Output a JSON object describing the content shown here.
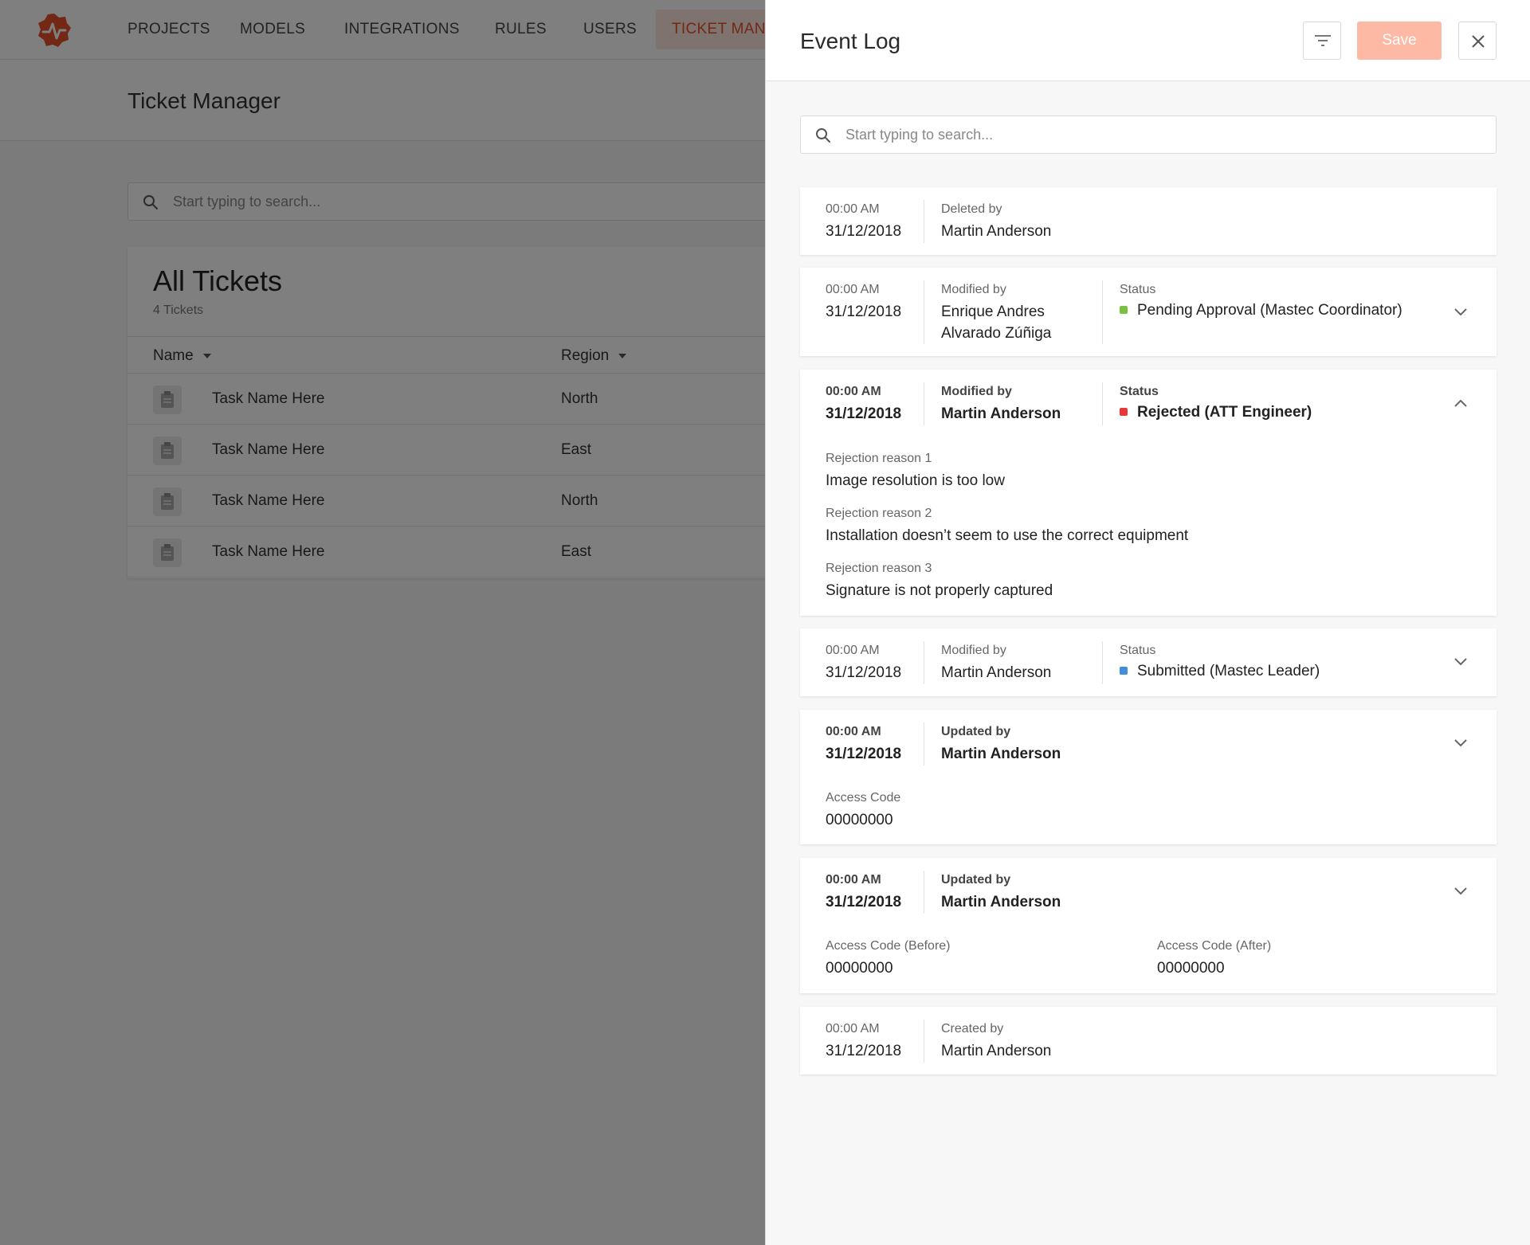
{
  "nav": {
    "items": [
      "PROJECTS",
      "MODELS",
      "INTEGRATIONS",
      "RULES",
      "USERS"
    ],
    "active_label": "TICKET MANA"
  },
  "page": {
    "title": "Ticket Manager"
  },
  "bg_search": {
    "placeholder": "Start typing to search..."
  },
  "tickets": {
    "title": "All Tickets",
    "count_label": "4 Tickets",
    "columns": [
      "Name",
      "Region"
    ],
    "rows": [
      {
        "name": "Task Name Here",
        "region": "North"
      },
      {
        "name": "Task Name Here",
        "region": "East"
      },
      {
        "name": "Task Name Here",
        "region": "North"
      },
      {
        "name": "Task Name Here",
        "region": "East"
      }
    ]
  },
  "panel": {
    "title": "Event Log",
    "save_label": "Save",
    "search_placeholder": "Start typing to search..."
  },
  "colors": {
    "accent": "#e5502a",
    "green": "#7ac143",
    "red": "#e8393a",
    "blue": "#3f8fde"
  },
  "events": [
    {
      "time": "00:00 AM",
      "date": "31/12/2018",
      "action": "Deleted by",
      "user": "Martin Anderson"
    },
    {
      "time": "00:00 AM",
      "date": "31/12/2018",
      "action": "Modified by",
      "user_line1": "Enrique Andres",
      "user_line2": "Alvarado Zúñiga",
      "status_label": "Status",
      "status": "Pending Approval (Mastec Coordinator)"
    },
    {
      "time": "00:00 AM",
      "date": "31/12/2018",
      "action": "Modified by",
      "user": "Martin Anderson",
      "status_label": "Status",
      "status": "Rejected (ATT Engineer)",
      "details": [
        {
          "label": "Rejection reason 1",
          "value": "Image resolution is too low"
        },
        {
          "label": "Rejection reason 2",
          "value": "Installation doesn’t seem to use the correct equipment"
        },
        {
          "label": "Rejection reason 3",
          "value": "Signature is not properly captured"
        }
      ]
    },
    {
      "time": "00:00 AM",
      "date": "31/12/2018",
      "action": "Modified by",
      "user": "Martin Anderson",
      "status_label": "Status",
      "status": "Submitted (Mastec Leader)"
    },
    {
      "time": "00:00 AM",
      "date": "31/12/2018",
      "action": "Updated by",
      "user": "Martin Anderson",
      "detail_label": "Access Code",
      "detail_value": "00000000"
    },
    {
      "time": "00:00 AM",
      "date": "31/12/2018",
      "action": "Updated by",
      "user": "Martin Anderson",
      "before_label": "Access Code (Before)",
      "before_value": "00000000",
      "after_label": "Access Code (After)",
      "after_value": "00000000"
    },
    {
      "time": "00:00 AM",
      "date": "31/12/2018",
      "action": "Created by",
      "user": "Martin Anderson"
    }
  ]
}
